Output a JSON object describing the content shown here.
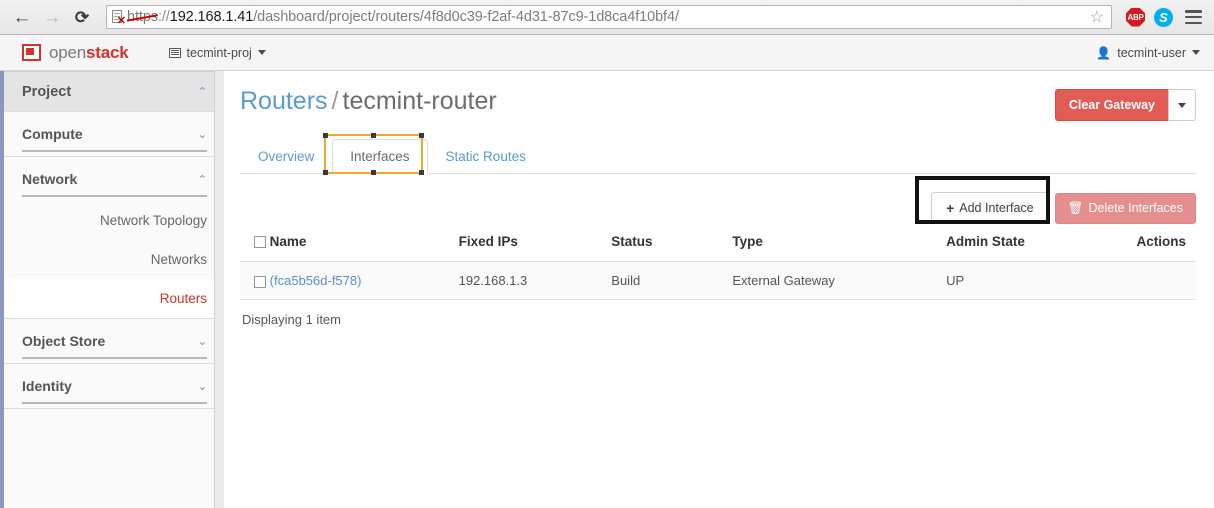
{
  "browser": {
    "back_icon": "←",
    "forward_icon": "→",
    "reload_icon": "⟳",
    "url": {
      "scheme": "https",
      "separator": "://",
      "host": "192.168.1.41",
      "path": "/dashboard/project/routers/4f8d0c39-f2af-4d31-87c9-1d8ca4f10bf4/"
    },
    "cert_warning_icon": "cert-invalid",
    "bookmark_icon": "☆",
    "extensions": [
      {
        "name": "adblock-plus",
        "label": "ABP"
      },
      {
        "name": "skype",
        "label": "S"
      }
    ],
    "menu_icon": "hamburger"
  },
  "topbar": {
    "logo_open": "open",
    "logo_stack": "stack",
    "project_selector": "tecmint-proj",
    "user_menu": "tecmint-user"
  },
  "sidebar": {
    "section_title": "Project",
    "groups": [
      {
        "label": "Compute",
        "expanded": false,
        "chevron": "⌄"
      },
      {
        "label": "Network",
        "expanded": true,
        "chevron": "⌃"
      }
    ],
    "network_items": [
      {
        "label": "Network Topology",
        "active": false
      },
      {
        "label": "Networks",
        "active": false
      },
      {
        "label": "Routers",
        "active": true
      }
    ],
    "lower_groups": [
      {
        "label": "Object Store",
        "expanded": false,
        "chevron": "⌄"
      },
      {
        "label": "Identity",
        "expanded": false,
        "chevron": "⌄"
      }
    ],
    "project_chevron": "⌃"
  },
  "page": {
    "breadcrumb_parent": "Routers",
    "breadcrumb_separator": "/",
    "breadcrumb_current": "tecmint-router",
    "clear_gateway_label": "Clear Gateway"
  },
  "tabs": [
    {
      "label": "Overview",
      "active": false
    },
    {
      "label": "Interfaces",
      "active": true
    },
    {
      "label": "Static Routes",
      "active": false
    }
  ],
  "actions": {
    "add_interface_label": "Add Interface",
    "add_interface_icon": "+",
    "delete_interfaces_label": "Delete Interfaces",
    "delete_interfaces_icon": "🗑"
  },
  "table": {
    "headers": [
      "Name",
      "Fixed IPs",
      "Status",
      "Type",
      "Admin State",
      "Actions"
    ],
    "rows": [
      {
        "name": "(fca5b56d-f578)",
        "fixed_ips": "192.168.1.3",
        "status": "Build",
        "type": "External Gateway",
        "admin_state": "UP",
        "actions": ""
      }
    ],
    "footer": "Displaying 1 item"
  },
  "colors": {
    "openstack_red": "#d5322e",
    "link_blue": "#5a9ad5",
    "highlight_orange": "#f0a830",
    "annotation_black": "#111111"
  }
}
